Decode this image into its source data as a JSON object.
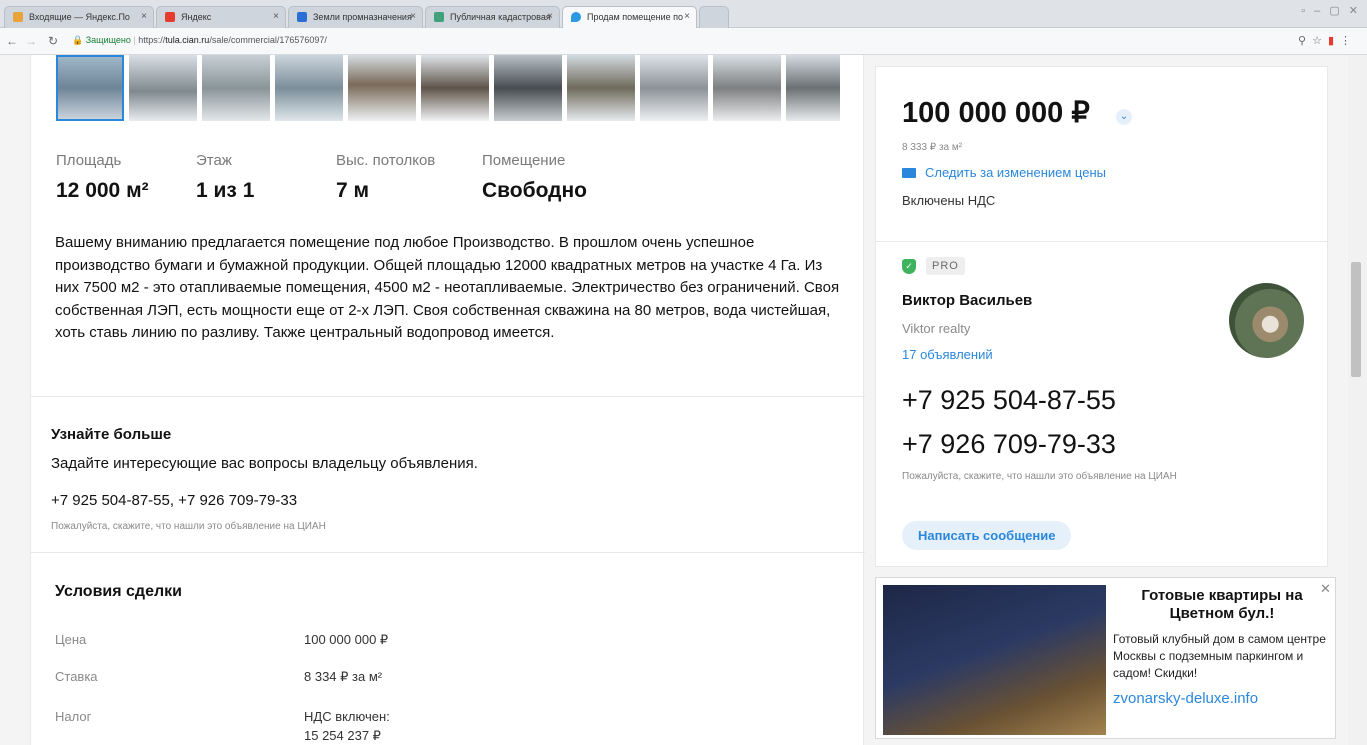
{
  "browser": {
    "tabs": [
      {
        "title": "Входящие — Яндекс.По",
        "color": "#e8a33a",
        "active": false
      },
      {
        "title": "Яндекс",
        "color": "#e63b2e",
        "active": false
      },
      {
        "title": "Земли промназначения",
        "color": "#2b6fd6",
        "active": false
      },
      {
        "title": "Публичная кадастровая",
        "color": "#3fa27a",
        "active": false
      },
      {
        "title": "Продам помещение по",
        "color": "#2b9ae0",
        "active": true
      }
    ],
    "secure_label": "Защищено",
    "url_scheme": "https://",
    "url_host": "tula.cian.ru",
    "url_path": "/sale/commercial/176576097/"
  },
  "gallery": {
    "thumb_count": 11,
    "selected_index": 0
  },
  "params": [
    {
      "label": "Площадь",
      "value": "12 000 м²"
    },
    {
      "label": "Этаж",
      "value": "1 из 1"
    },
    {
      "label": "Выс. потолков",
      "value": "7 м"
    },
    {
      "label": "Помещение",
      "value": "Свободно"
    }
  ],
  "description": "Вашему вниманию предлагается помещение под любое Производство. В прошлом очень успешное производство бумаги и бумажной продукции. Общей площадью 12000 квадратных метров на участке 4 Га. Из них 7500 м2 - это отапливаемые помещения, 4500 м2 - неотапливаемые. Электричество без ограничений. Своя собственная ЛЭП, есть мощности еще от 2-х ЛЭП. Своя собственная скважина на 80 метров, вода чистейшая, хоть ставь линию по разливу. Также центральный водопровод имеется.",
  "learn_more": {
    "title": "Узнайте больше",
    "text": "Задайте интересующие вас вопросы владельцу объявления.",
    "phones": "+7 925 504-87-55, +7 926 709-79-33",
    "note": "Пожалуйста, скажите, что нашли это объявление на ЦИАН"
  },
  "deal": {
    "title": "Условия сделки",
    "rows": [
      {
        "label": "Цена",
        "value": "100 000 000 ₽"
      },
      {
        "label": "Ставка",
        "value": "8 334 ₽ за м²"
      },
      {
        "label": "Налог",
        "value": "НДС включен:"
      },
      {
        "label": "",
        "value": "15 254 237 ₽"
      }
    ]
  },
  "offer": {
    "price": "100 000 000 ₽",
    "price_per_m2": "8 333 ₽ за м²",
    "follow": "Следить за изменением цены",
    "vat": "Включены НДС"
  },
  "agent": {
    "badge": "PRO",
    "name": "Виктор Васильев",
    "company": "Viktor realty",
    "listings": "17 объявлений",
    "phones": [
      "+7 925 504-87-55",
      "+7 926 709-79-33"
    ],
    "note": "Пожалуйста, скажите, что нашли это объявление на ЦИАН",
    "message_button": "Написать сообщение"
  },
  "ad": {
    "title": "Готовые квартиры на Цветном бул.!",
    "text": "Готовый клубный дом в самом центре Москвы с подземным паркингом и садом! Скидки!",
    "link": "zvonarsky-deluxe.info"
  },
  "colors": {
    "accent": "#2b87db",
    "verified": "#3cb35c"
  }
}
